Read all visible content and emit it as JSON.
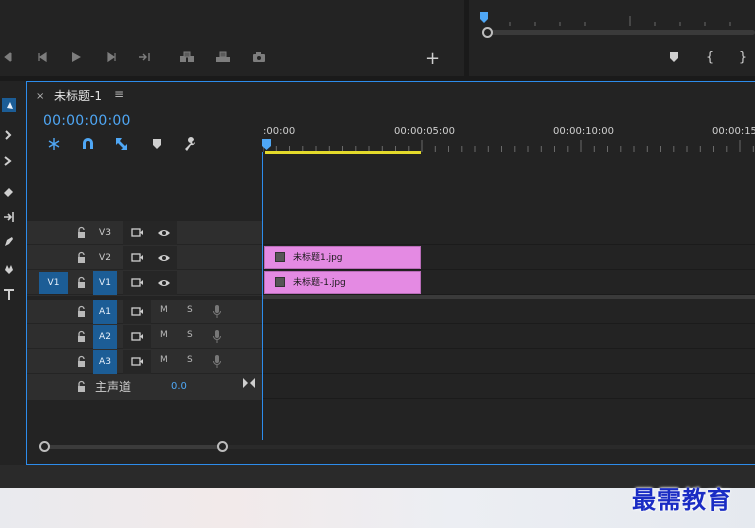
{
  "sequence_tab": {
    "title": "未标题-1",
    "close": "×",
    "menu": "≡"
  },
  "timecode": "00:00:00:00",
  "ruler": {
    "labels": [
      ":00:00",
      "00:00:05:00",
      "00:00:10:00",
      "00:00:15"
    ]
  },
  "video_tracks": [
    {
      "name": "V3",
      "targeted": false
    },
    {
      "name": "V2",
      "targeted": false
    },
    {
      "name": "V1",
      "targeted": true,
      "source": "V1"
    }
  ],
  "audio_tracks": [
    {
      "name": "A1",
      "mute": "M",
      "solo": "S"
    },
    {
      "name": "A2",
      "mute": "M",
      "solo": "S"
    },
    {
      "name": "A3",
      "mute": "M",
      "solo": "S"
    }
  ],
  "master": {
    "label": "主声道",
    "value": "0.0"
  },
  "clips": [
    {
      "label": "未标题1.jpg",
      "track": "V2"
    },
    {
      "label": "未标题-1.jpg",
      "track": "V1"
    }
  ],
  "add_button": "+",
  "watermark": "最需教育",
  "colors": {
    "accent": "#2d8ceb",
    "timecode": "#4fa7f5",
    "clip": "#e48ae3",
    "workarea": "#e4da2b",
    "target": "#1c5d96"
  }
}
